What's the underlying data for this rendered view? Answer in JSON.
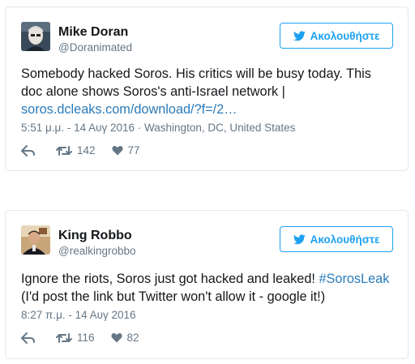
{
  "tweets": [
    {
      "name": "Mike Doran",
      "handle": "@Doranimated",
      "follow_label": "Ακολουθήστε",
      "text": "Somebody hacked Soros. His critics will be busy today. This doc alone shows Soros's anti-Israel network |",
      "link": "soros.dcleaks.com/download/?f=/2…",
      "timestamp": "5:51 μ.μ. - 14 Αυγ 2016",
      "location": "Washington, DC, United States",
      "retweets": "142",
      "likes": "77"
    },
    {
      "name": "King Robbo",
      "handle": "@realkingrobbo",
      "follow_label": "Ακολουθήστε",
      "text_before": "Ignore the riots, Soros just got hacked and leaked!",
      "hashtag": "#SorosLeak",
      "text_after": "(I'd post the link but Twitter won't allow it - google it!)",
      "timestamp": "8:27 π.μ. - 14 Αυγ 2016",
      "retweets": "116",
      "likes": "82"
    }
  ],
  "icons": {
    "bird": "twitter-bird-icon",
    "reply": "reply-icon",
    "retweet": "retweet-icon",
    "like": "heart-icon"
  },
  "colors": {
    "accent": "#1da1f2",
    "link": "#2b7bb9",
    "muted": "#657786",
    "border": "#e1e8ed"
  }
}
